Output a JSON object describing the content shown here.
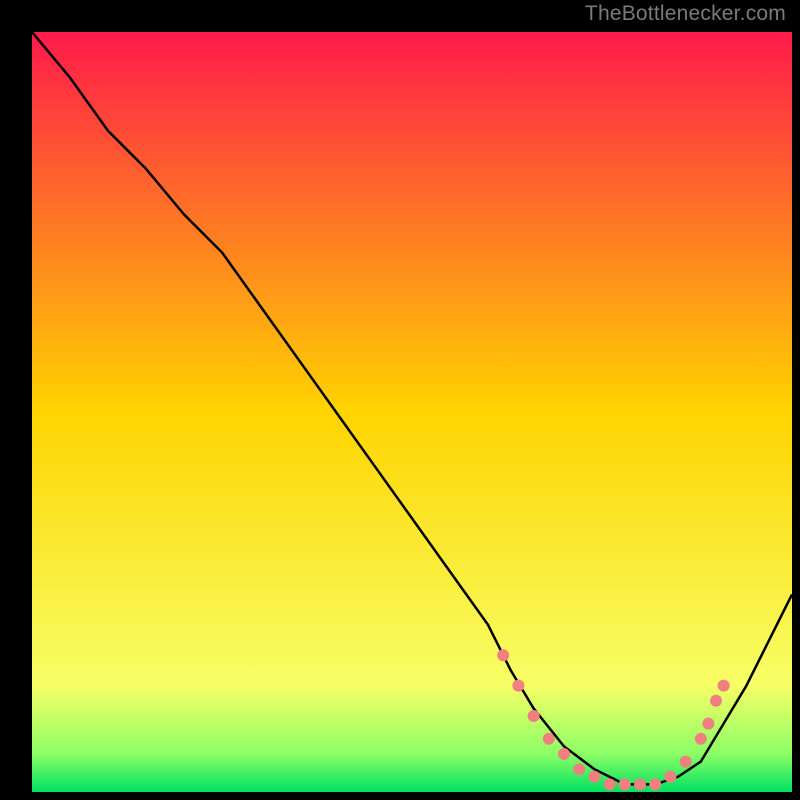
{
  "watermark": "TheBottlenecker.com",
  "chart_data": {
    "type": "line",
    "title": "",
    "xlabel": "",
    "ylabel": "",
    "axes_visible": false,
    "xlim": [
      0,
      100
    ],
    "ylim": [
      0,
      100
    ],
    "background_gradient": [
      {
        "pos": 0.0,
        "color": "#ff1a4a"
      },
      {
        "pos": 0.5,
        "color": "#ffd400"
      },
      {
        "pos": 0.86,
        "color": "#f7ff66"
      },
      {
        "pos": 0.95,
        "color": "#8cff66"
      },
      {
        "pos": 1.0,
        "color": "#00e060"
      }
    ],
    "series": [
      {
        "name": "curve",
        "color": "#000000",
        "x": [
          0,
          5,
          10,
          15,
          20,
          25,
          30,
          35,
          40,
          45,
          50,
          55,
          60,
          63,
          66,
          70,
          74,
          78,
          82,
          85,
          88,
          91,
          94,
          97,
          100
        ],
        "y": [
          100,
          94,
          87,
          82,
          76,
          71,
          64,
          57,
          50,
          43,
          36,
          29,
          22,
          16,
          11,
          6,
          3,
          1,
          1,
          2,
          4,
          9,
          14,
          20,
          26
        ]
      }
    ],
    "markers": {
      "color": "#f08080",
      "radius": 6,
      "points": [
        {
          "x": 62,
          "y": 18
        },
        {
          "x": 64,
          "y": 14
        },
        {
          "x": 66,
          "y": 10
        },
        {
          "x": 68,
          "y": 7
        },
        {
          "x": 70,
          "y": 5
        },
        {
          "x": 72,
          "y": 3
        },
        {
          "x": 74,
          "y": 2
        },
        {
          "x": 76,
          "y": 1
        },
        {
          "x": 78,
          "y": 1
        },
        {
          "x": 80,
          "y": 1
        },
        {
          "x": 82,
          "y": 1
        },
        {
          "x": 84,
          "y": 2
        },
        {
          "x": 86,
          "y": 4
        },
        {
          "x": 88,
          "y": 7
        },
        {
          "x": 89,
          "y": 9
        },
        {
          "x": 90,
          "y": 12
        },
        {
          "x": 91,
          "y": 14
        }
      ]
    }
  }
}
